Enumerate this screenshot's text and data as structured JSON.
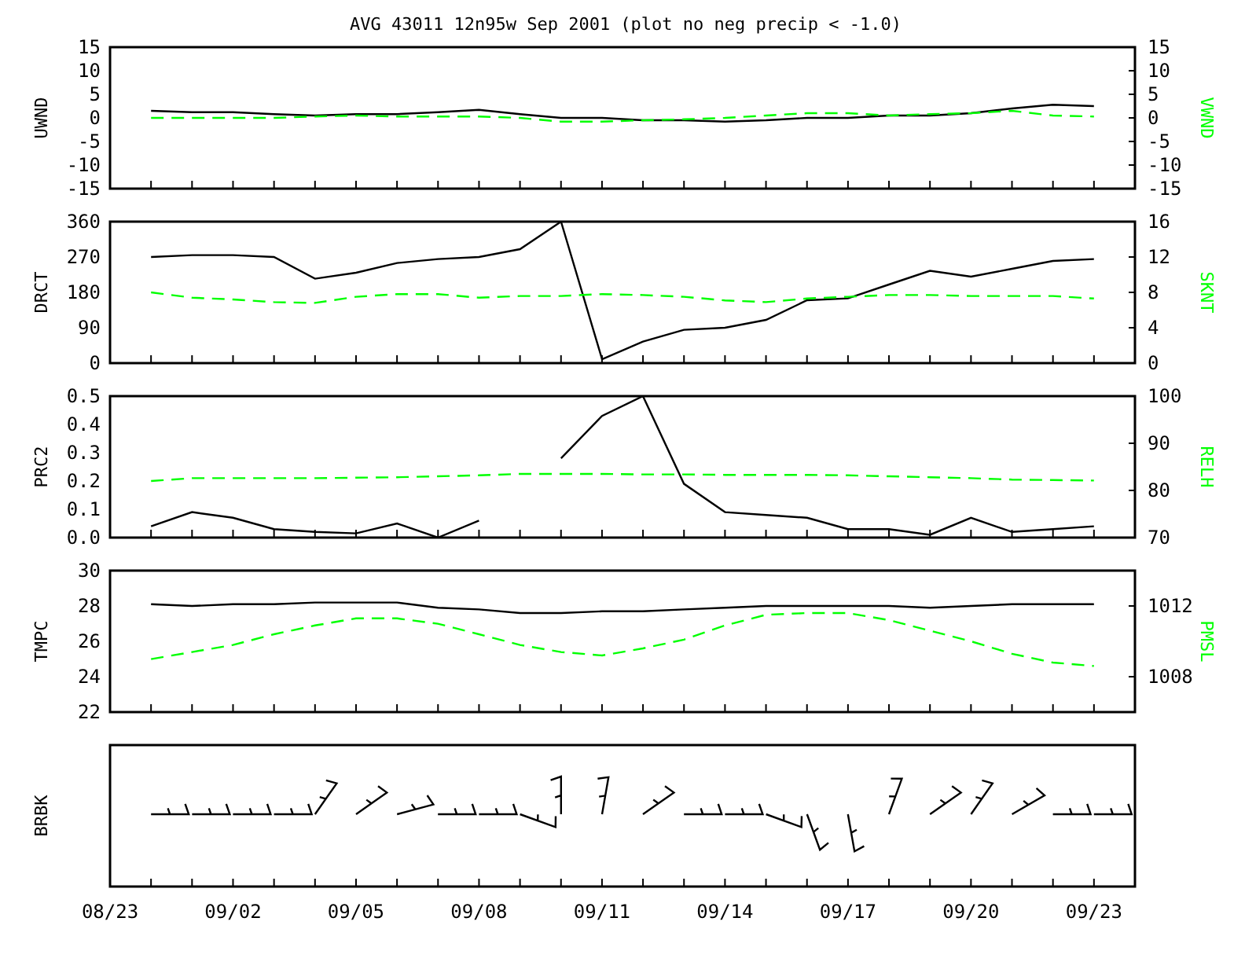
{
  "title": "AVG 43011 12n95w Sep 2001 (plot no neg precip < -1.0)",
  "panels": [
    {
      "kind": "lines",
      "left_chart": {
        "chart_data": {
          "type": "line",
          "categories": [
            null,
            null,
            null,
            null,
            null,
            null,
            null,
            null,
            null,
            null,
            null,
            null,
            null,
            null,
            null,
            null,
            null,
            null,
            null,
            null,
            null,
            null,
            null,
            null
          ],
          "ylim": [
            -15,
            15
          ],
          "yticks": [
            -15,
            -10,
            -5,
            0,
            5,
            10,
            15
          ],
          "series": [
            {
              "name": "UWND",
              "color": "#000000",
              "line_style": "solid",
              "values": [
                1.5,
                1.2,
                1.2,
                0.8,
                0.5,
                0.8,
                0.8,
                1.2,
                1.7,
                0.8,
                0,
                0,
                -0.5,
                -0.5,
                -0.8,
                -0.5,
                0,
                0,
                0.5,
                0.5,
                1,
                2,
                2.8,
                2.5
              ]
            }
          ]
        }
      },
      "right_chart": {
        "chart_data": {
          "type": "line",
          "categories": [
            null,
            null,
            null,
            null,
            null,
            null,
            null,
            null,
            null,
            null,
            null,
            null,
            null,
            null,
            null,
            null,
            null,
            null,
            null,
            null,
            null,
            null,
            null,
            null
          ],
          "ylim": [
            -15,
            15
          ],
          "yticks": [
            -15,
            -10,
            -5,
            0,
            5,
            10,
            15
          ],
          "series": [
            {
              "name": "VWND",
              "color": "#00ff00",
              "line_style": "dashed",
              "values": [
                0,
                0,
                0,
                0,
                0.3,
                0.5,
                0.3,
                0.3,
                0.3,
                0,
                -0.8,
                -0.8,
                -0.5,
                -0.3,
                0,
                0.5,
                1,
                1,
                0.5,
                0.8,
                1,
                1.5,
                0.5,
                0.3
              ]
            }
          ]
        }
      }
    },
    {
      "kind": "lines",
      "left_chart": {
        "chart_data": {
          "type": "line",
          "categories": [
            null,
            null,
            null,
            null,
            null,
            null,
            null,
            null,
            null,
            null,
            null,
            null,
            null,
            null,
            null,
            null,
            null,
            null,
            null,
            null,
            null,
            null,
            null,
            null
          ],
          "ylim": [
            0,
            360
          ],
          "yticks": [
            0,
            90,
            180,
            270,
            360
          ],
          "series": [
            {
              "name": "DRCT",
              "color": "#000000",
              "line_style": "solid",
              "values": [
                270,
                275,
                275,
                270,
                215,
                230,
                255,
                265,
                270,
                290,
                360,
                10,
                55,
                85,
                90,
                110,
                160,
                165,
                200,
                235,
                220,
                240,
                260,
                265
              ]
            }
          ]
        }
      },
      "right_chart": {
        "chart_data": {
          "type": "line",
          "categories": [
            null,
            null,
            null,
            null,
            null,
            null,
            null,
            null,
            null,
            null,
            null,
            null,
            null,
            null,
            null,
            null,
            null,
            null,
            null,
            null,
            null,
            null,
            null,
            null
          ],
          "ylim": [
            0,
            16
          ],
          "yticks": [
            0,
            4,
            8,
            12,
            16
          ],
          "series": [
            {
              "name": "SKNT",
              "color": "#00ff00",
              "line_style": "dashed",
              "values": [
                8,
                7.4,
                7.2,
                6.9,
                6.8,
                7.5,
                7.8,
                7.8,
                7.4,
                7.6,
                7.6,
                7.8,
                7.7,
                7.5,
                7.1,
                6.9,
                7.3,
                7.5,
                7.7,
                7.7,
                7.6,
                7.6,
                7.6,
                7.3
              ]
            }
          ]
        }
      }
    },
    {
      "kind": "lines",
      "left_chart": {
        "chart_data": {
          "type": "line",
          "categories": [
            null,
            null,
            null,
            null,
            null,
            null,
            null,
            null,
            null,
            null,
            null,
            null,
            null,
            null,
            null,
            null,
            null,
            null,
            null,
            null,
            null,
            null,
            null,
            null
          ],
          "ylim": [
            0,
            0.5
          ],
          "yticks": [
            {
              "value": 0,
              "label": "0.0"
            },
            {
              "value": 0.1,
              "label": "0.1"
            },
            {
              "value": 0.2,
              "label": "0.2"
            },
            {
              "value": 0.3,
              "label": "0.3"
            },
            {
              "value": 0.4,
              "label": "0.4"
            },
            {
              "value": 0.5,
              "label": "0.5"
            }
          ],
          "series": [
            {
              "name": "PRC2",
              "color": "#000000",
              "line_style": "solid",
              "values": [
                0.04,
                0.09,
                0.07,
                0.03,
                0.02,
                0.015,
                0.05,
                0,
                0.06,
                null,
                0.28,
                0.43,
                0.5,
                0.19,
                0.09,
                0.08,
                0.07,
                0.03,
                0.03,
                0.01,
                0.07,
                0.02,
                0.03,
                0.04
              ]
            }
          ]
        }
      },
      "right_chart": {
        "chart_data": {
          "type": "line",
          "categories": [
            null,
            null,
            null,
            null,
            null,
            null,
            null,
            null,
            null,
            null,
            null,
            null,
            null,
            null,
            null,
            null,
            null,
            null,
            null,
            null,
            null,
            null,
            null,
            null
          ],
          "ylim": [
            70,
            100
          ],
          "yticks": [
            70,
            80,
            90,
            100
          ],
          "series": [
            {
              "name": "RELH",
              "color": "#00ff00",
              "line_style": "dashed",
              "values": [
                82,
                82.6,
                82.6,
                82.6,
                82.6,
                82.7,
                82.8,
                83,
                83.2,
                83.5,
                83.5,
                83.5,
                83.4,
                83.4,
                83.3,
                83.3,
                83.3,
                83.2,
                83,
                82.8,
                82.6,
                82.3,
                82.2,
                82.1
              ]
            }
          ]
        }
      }
    },
    {
      "kind": "lines",
      "left_chart": {
        "chart_data": {
          "type": "line",
          "categories": [
            null,
            null,
            null,
            null,
            null,
            null,
            null,
            null,
            null,
            null,
            null,
            null,
            null,
            null,
            null,
            null,
            null,
            null,
            null,
            null,
            null,
            null,
            null,
            null
          ],
          "ylim": [
            22,
            30
          ],
          "yticks": [
            22,
            24,
            26,
            28,
            30
          ],
          "series": [
            {
              "name": "TMPC",
              "color": "#000000",
              "line_style": "solid",
              "values": [
                28.1,
                28,
                28.1,
                28.1,
                28.2,
                28.2,
                28.2,
                27.9,
                27.8,
                27.6,
                27.6,
                27.7,
                27.7,
                27.8,
                27.9,
                28,
                28,
                28,
                28,
                27.9,
                28,
                28.1,
                28.1,
                28.1
              ]
            }
          ]
        }
      },
      "right_chart": {
        "chart_data": {
          "type": "line",
          "categories": [
            null,
            null,
            null,
            null,
            null,
            null,
            null,
            null,
            null,
            null,
            null,
            null,
            null,
            null,
            null,
            null,
            null,
            null,
            null,
            null,
            null,
            null,
            null,
            null
          ],
          "ylim": [
            1006,
            1014
          ],
          "yticks": [
            1008,
            1012
          ],
          "series": [
            {
              "name": "PMSL",
              "color": "#00ff00",
              "line_style": "dashed",
              "values": [
                1009,
                1009.4,
                1009.8,
                1010.4,
                1010.9,
                1011.3,
                1011.3,
                1011,
                1010.4,
                1009.8,
                1009.4,
                1009.2,
                1009.6,
                1010.1,
                1010.9,
                1011.5,
                1011.6,
                1011.6,
                1011.2,
                1010.6,
                1010,
                1009.3,
                1008.8,
                1008.6
              ]
            }
          ]
        }
      }
    },
    {
      "kind": "barbs",
      "label": "BRBK"
    }
  ],
  "time_axis": {
    "labels": [
      "08/23",
      "09/02",
      "09/05",
      "09/08",
      "09/11",
      "09/14",
      "09/17",
      "09/20",
      "09/23"
    ]
  }
}
